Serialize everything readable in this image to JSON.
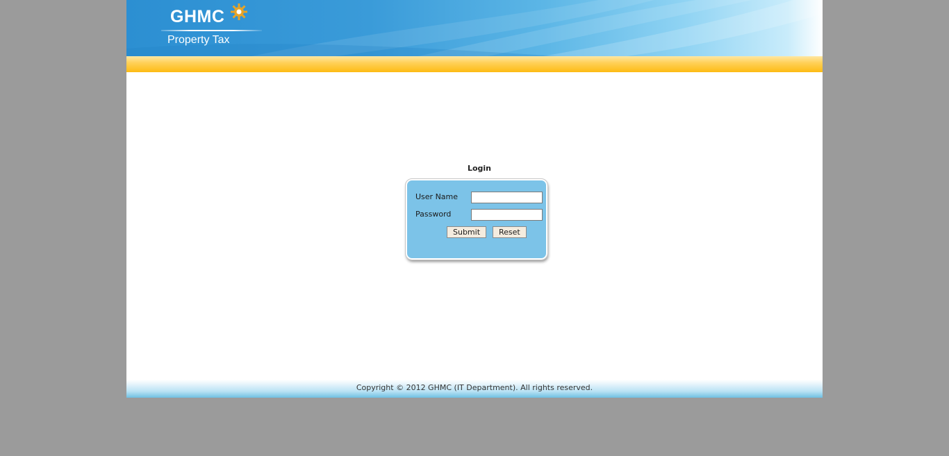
{
  "header": {
    "logo_title": "GHMC",
    "logo_subtitle": "Property Tax",
    "colors": {
      "banner_blue": "#2c8fd2",
      "accent_yellow": "#fdbb14",
      "logo_gear": "#e8a427"
    }
  },
  "login": {
    "title": "Login",
    "username_label": "User Name",
    "username_value": "",
    "password_label": "Password",
    "password_value": "",
    "submit_label": "Submit",
    "reset_label": "Reset",
    "box_color": "#7cc3e8"
  },
  "footer": {
    "copyright": "Copyright © 2012 GHMC (IT Department). All rights reserved."
  }
}
